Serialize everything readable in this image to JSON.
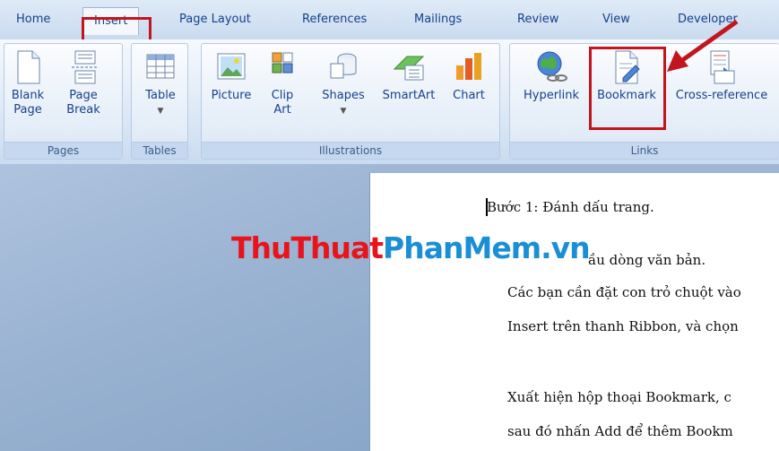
{
  "tabs": [
    "Home",
    "Insert",
    "Page Layout",
    "References",
    "Mailings",
    "Review",
    "View",
    "Developer"
  ],
  "active_tab": "Insert",
  "groups": {
    "pages": {
      "label": "Pages",
      "buttons": [
        "Blank\nPage",
        "Page\nBreak"
      ]
    },
    "tables": {
      "label": "Tables",
      "buttons": [
        "Table"
      ]
    },
    "illustrations": {
      "label": "Illustrations",
      "buttons": [
        "Picture",
        "Clip\nArt",
        "Shapes",
        "SmartArt",
        "Chart"
      ]
    },
    "links": {
      "label": "Links",
      "buttons": [
        "Hyperlink",
        "Bookmark",
        "Cross-reference"
      ]
    }
  },
  "document": {
    "lines": [
      "Bước 1: Đánh dấu trang.",
      "ầu dòng văn bản.",
      "Các bạn cần đặt con trỏ chuột vào",
      "Insert trên thanh Ribbon, và chọn",
      "Xuất hiện hộp thoại Bookmark, c",
      "sau đó nhấn Add để thêm Bookm"
    ]
  },
  "watermark": {
    "part1": "ThuThuat",
    "part2": "PhanMem.vn"
  },
  "colors": {
    "highlight": "#c3151e",
    "ribbon_text": "#15428b"
  }
}
